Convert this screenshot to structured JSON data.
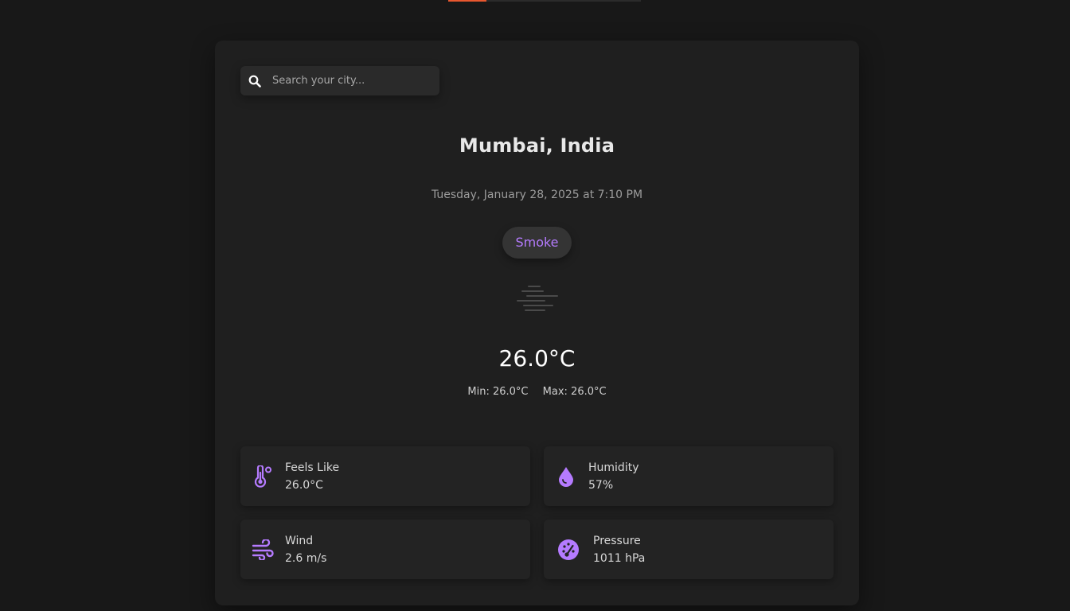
{
  "loading_bar": {
    "progress_fraction": 0.2
  },
  "search": {
    "placeholder": "Search your city...",
    "value": ""
  },
  "location": {
    "city": "Mumbai, India"
  },
  "datetime": "Tuesday, January 28, 2025 at 7:10 PM",
  "condition": "Smoke",
  "temperature": "26.0°C",
  "min": "Min: 26.0°C",
  "max": "Max: 26.0°C",
  "stats": [
    {
      "label": "Feels Like",
      "value": "26.0°C",
      "icon": "thermometer-icon"
    },
    {
      "label": "Humidity",
      "value": "57%",
      "icon": "droplet-icon"
    },
    {
      "label": "Wind",
      "value": "2.6 m/s",
      "icon": "wind-icon"
    },
    {
      "label": "Pressure",
      "value": "1011 hPa",
      "icon": "gauge-icon"
    }
  ],
  "colors": {
    "accent": "#b57bff",
    "loading": "#e8572f",
    "background": "#181818",
    "card": "#1f1f1f"
  }
}
